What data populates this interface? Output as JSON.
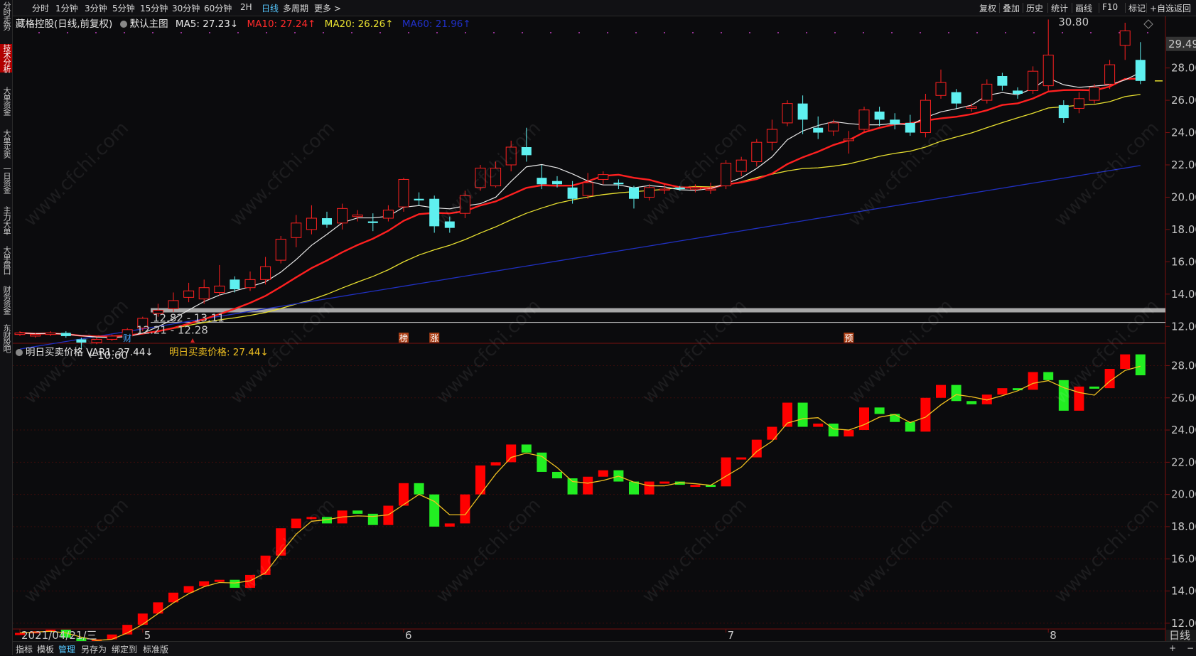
{
  "left_tabs": [
    {
      "label": "分时走势",
      "active": false
    },
    {
      "label": "技术分析",
      "active": true
    },
    {
      "label": "大单资金",
      "active": false
    },
    {
      "label": "大单买卖",
      "active": false
    },
    {
      "label": "一日资金",
      "active": false
    },
    {
      "label": "主力大单",
      "active": false
    },
    {
      "label": "大单盘口",
      "active": false
    },
    {
      "label": "财务资金",
      "active": false
    },
    {
      "label": "东财股吧",
      "active": false
    }
  ],
  "periods": [
    {
      "label": "分时",
      "active": false
    },
    {
      "label": "1分钟",
      "active": false
    },
    {
      "label": "3分钟",
      "active": false
    },
    {
      "label": "5分钟",
      "active": false
    },
    {
      "label": "15分钟",
      "active": false
    },
    {
      "label": "30分钟",
      "active": false
    },
    {
      "label": "60分钟",
      "active": false
    },
    {
      "label": "2H",
      "active": false
    },
    {
      "label": "日线",
      "active": true
    },
    {
      "label": "多周期",
      "active": false
    },
    {
      "label": "更多 >",
      "active": false
    }
  ],
  "right_tools": [
    "复权",
    "叠加",
    "历史",
    "统计",
    "画线",
    "F10",
    "标记",
    "+自选",
    "返回"
  ],
  "main_info": {
    "stock": "藏格控股(日线,前复权)",
    "template": "默认主图",
    "ma5": "MA5: 27.23↓",
    "ma10": "MA10: 27.24↑",
    "ma20": "MA20: 26.26↑",
    "ma60": "MA60: 21.96↑"
  },
  "sub_info": {
    "name": "明日买卖价格",
    "var1": "VAR1: 27.44↓",
    "value": "明日买卖价格: 27.44↓"
  },
  "colors": {
    "up": "#ff2020",
    "down": "#5ff0f0",
    "ma5": "#e8e8e8",
    "ma10": "#ff2020",
    "ma20": "#e8e030",
    "ma60": "#2030c0",
    "sub_up": "#ff0000",
    "sub_down": "#22ee22",
    "sub_line": "#f0c020"
  },
  "annotations": {
    "high_label": "30.80",
    "low_label": "10.60",
    "last_price": "29.49",
    "range1": "12.82 - 13.11",
    "range2": "12.21 - 12.28",
    "markers": [
      "财",
      "榜",
      "涨",
      "预"
    ]
  },
  "watermark": "www.cfchi.com",
  "chart_data": [
    {
      "type": "candlestick",
      "title": "藏格控股(日线,前复权)",
      "ylim": [
        11,
        30.8
      ],
      "y_ticks": [
        12,
        14,
        16,
        18,
        20,
        22,
        24,
        26,
        28
      ],
      "x_tick_labels": [
        "2021/04/21/三",
        "5",
        "6",
        "7",
        "8"
      ],
      "x_tick_index": [
        0,
        8,
        25,
        46,
        67
      ],
      "candles": [
        [
          11.5,
          11.6,
          11.7,
          11.4
        ],
        [
          11.4,
          11.5,
          11.6,
          11.3
        ],
        [
          11.5,
          11.6,
          11.7,
          11.4
        ],
        [
          11.6,
          11.4,
          11.7,
          11.3
        ],
        [
          11.2,
          11.0,
          11.3,
          10.6
        ],
        [
          11.0,
          11.2,
          11.3,
          10.9
        ],
        [
          11.2,
          11.4,
          11.5,
          11.1
        ],
        [
          11.4,
          11.8,
          11.9,
          11.3
        ],
        [
          11.9,
          12.5,
          12.6,
          11.7
        ],
        [
          12.8,
          13.0,
          13.4,
          12.6
        ],
        [
          13.1,
          13.6,
          14.1,
          12.9
        ],
        [
          13.8,
          14.2,
          14.7,
          13.5
        ],
        [
          13.7,
          14.4,
          14.9,
          13.4
        ],
        [
          14.1,
          14.5,
          15.8,
          13.9
        ],
        [
          14.9,
          14.3,
          15.1,
          14.1
        ],
        [
          14.4,
          14.9,
          15.4,
          14.2
        ],
        [
          14.9,
          15.7,
          16.3,
          14.6
        ],
        [
          16.1,
          17.4,
          17.6,
          15.9
        ],
        [
          17.5,
          18.4,
          18.9,
          16.9
        ],
        [
          18.0,
          18.7,
          19.5,
          17.7
        ],
        [
          18.7,
          18.3,
          19.1,
          18.1
        ],
        [
          18.4,
          19.3,
          19.6,
          18.0
        ],
        [
          18.8,
          18.9,
          19.2,
          18.5
        ],
        [
          18.5,
          18.4,
          19.0,
          17.9
        ],
        [
          18.7,
          19.2,
          19.5,
          18.5
        ],
        [
          19.4,
          21.1,
          21.2,
          19.1
        ],
        [
          19.9,
          19.8,
          20.3,
          19.5
        ],
        [
          19.9,
          18.2,
          20.1,
          17.8
        ],
        [
          18.5,
          18.1,
          18.8,
          17.8
        ],
        [
          19.0,
          20.1,
          20.4,
          18.7
        ],
        [
          20.6,
          21.8,
          22.0,
          20.4
        ],
        [
          20.7,
          21.8,
          22.2,
          20.6
        ],
        [
          22.0,
          23.1,
          23.5,
          21.6
        ],
        [
          23.1,
          22.6,
          24.3,
          22.2
        ],
        [
          21.2,
          20.8,
          22.0,
          20.5
        ],
        [
          21.0,
          20.8,
          21.3,
          20.6
        ],
        [
          20.6,
          19.9,
          21.0,
          19.6
        ],
        [
          20.1,
          20.9,
          21.5,
          19.9
        ],
        [
          21.1,
          21.4,
          21.6,
          20.8
        ],
        [
          20.9,
          20.8,
          21.1,
          20.5
        ],
        [
          20.6,
          19.9,
          20.7,
          19.3
        ],
        [
          20.0,
          20.6,
          20.8,
          19.8
        ],
        [
          20.5,
          20.5,
          20.8,
          20.2
        ],
        [
          20.6,
          20.5,
          20.7,
          20.4
        ],
        [
          20.5,
          20.6,
          20.8,
          20.3
        ],
        [
          20.5,
          20.5,
          20.9,
          20.2
        ],
        [
          20.7,
          22.1,
          22.3,
          20.5
        ],
        [
          21.6,
          22.3,
          22.5,
          21.3
        ],
        [
          22.2,
          23.4,
          23.6,
          21.9
        ],
        [
          23.4,
          24.2,
          24.8,
          22.9
        ],
        [
          24.6,
          25.8,
          26.0,
          24.4
        ],
        [
          25.8,
          24.8,
          26.3,
          23.9
        ],
        [
          24.3,
          24.0,
          25.0,
          23.6
        ],
        [
          24.1,
          24.6,
          24.8,
          23.8
        ],
        [
          23.5,
          23.6,
          24.1,
          22.7
        ],
        [
          24.2,
          25.4,
          25.6,
          24.0
        ],
        [
          25.3,
          24.8,
          25.6,
          24.4
        ],
        [
          24.8,
          24.5,
          25.2,
          24.2
        ],
        [
          24.6,
          24.0,
          25.1,
          23.8
        ],
        [
          24.0,
          26.0,
          26.4,
          23.7
        ],
        [
          26.3,
          27.1,
          27.9,
          26.1
        ],
        [
          26.5,
          25.8,
          26.7,
          25.5
        ],
        [
          25.5,
          25.6,
          25.8,
          25.3
        ],
        [
          26.0,
          27.0,
          27.3,
          25.8
        ],
        [
          27.5,
          26.9,
          27.7,
          26.6
        ],
        [
          26.6,
          26.4,
          26.8,
          26.1
        ],
        [
          26.6,
          27.8,
          28.1,
          26.4
        ],
        [
          26.9,
          28.8,
          31.0,
          26.6
        ],
        [
          25.7,
          24.9,
          26.0,
          24.6
        ],
        [
          25.5,
          26.1,
          26.5,
          25.2
        ],
        [
          26.0,
          26.8,
          27.0,
          25.8
        ],
        [
          27.0,
          28.2,
          28.5,
          26.7
        ],
        [
          29.4,
          30.3,
          30.8,
          28.5
        ],
        [
          28.5,
          27.2,
          29.6,
          27.0
        ]
      ],
      "ma_series": [
        "MA5",
        "MA10",
        "MA20",
        "MA60"
      ]
    },
    {
      "type": "bar",
      "title": "明日买卖价格",
      "ylim": [
        11.2,
        29.3
      ],
      "y_ticks": [
        12,
        14,
        16,
        18,
        20,
        22,
        24,
        26,
        28
      ],
      "series": [
        {
          "name": "VAR1",
          "values": [
            11.4,
            11.5,
            11.6,
            11.1,
            10.7,
            11.0,
            11.3,
            11.9,
            12.6,
            13.3,
            13.9,
            14.3,
            14.6,
            14.7,
            14.2,
            15.0,
            16.2,
            17.9,
            18.5,
            18.6,
            18.2,
            19.0,
            18.8,
            18.1,
            19.3,
            20.7,
            20.0,
            18.0,
            18.2,
            20.0,
            21.8,
            22.0,
            23.1,
            22.6,
            21.4,
            21.0,
            20.0,
            21.1,
            21.5,
            20.8,
            20.0,
            20.8,
            20.8,
            20.6,
            20.6,
            20.5,
            22.3,
            22.3,
            23.4,
            24.2,
            25.7,
            24.2,
            24.4,
            23.6,
            24.0,
            25.4,
            25.0,
            24.5,
            23.9,
            26.0,
            26.8,
            25.8,
            25.6,
            26.2,
            26.6,
            26.5,
            27.6,
            27.1,
            25.2,
            26.7,
            26.6,
            27.8,
            28.7,
            27.4
          ]
        }
      ]
    }
  ]
}
